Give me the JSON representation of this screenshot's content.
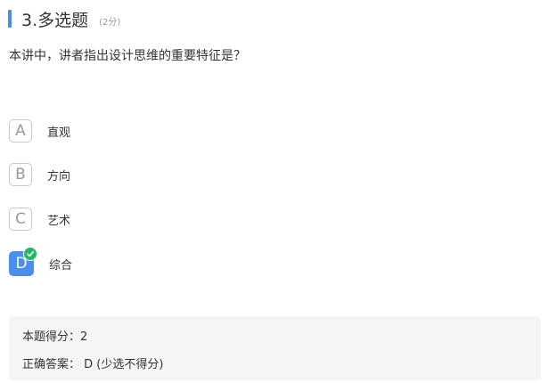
{
  "question": {
    "title": "3.多选题",
    "score": "(2分)",
    "text": "本讲中，讲者指出设计思维的重要特征是？"
  },
  "options": [
    {
      "letter": "A",
      "label": "直观",
      "selected": false
    },
    {
      "letter": "B",
      "label": "方向",
      "selected": false
    },
    {
      "letter": "C",
      "label": "艺术",
      "selected": false
    },
    {
      "letter": "D",
      "label": "综合",
      "selected": true
    }
  ],
  "result": {
    "score_line": "本题得分：2",
    "answer_line": "正确答案：  D (少选不得分)"
  },
  "colors": {
    "accent": "#4a90e2",
    "selected": "#4a8ef0",
    "check": "#25b864",
    "panel": "#f5f5f5"
  },
  "icons": {
    "selected_badge": "check-icon"
  }
}
